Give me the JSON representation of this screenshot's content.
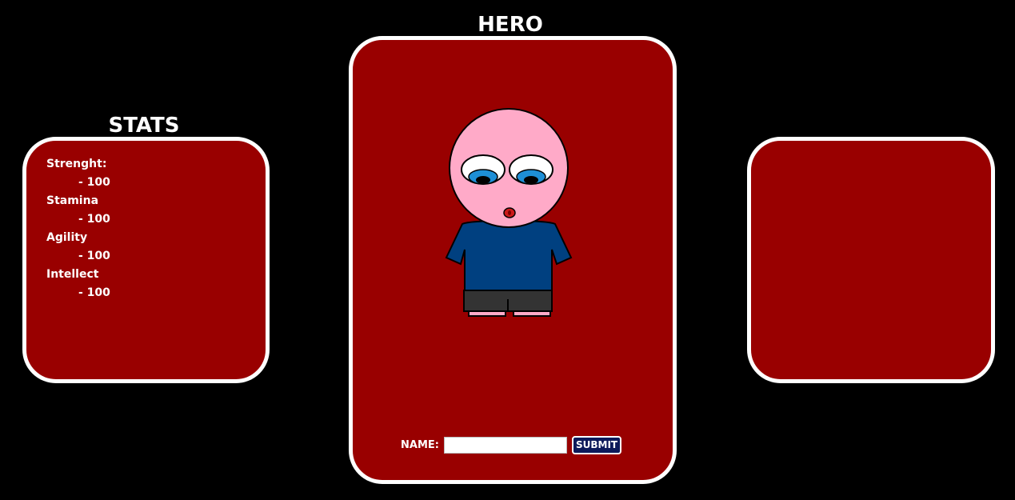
{
  "stats": {
    "title": "STATS",
    "items": [
      {
        "label": "Strenght:",
        "value": "- 100"
      },
      {
        "label": "Stamina",
        "value": "- 100"
      },
      {
        "label": "Agility",
        "value": "- 100"
      },
      {
        "label": "Intellect",
        "value": "- 100"
      }
    ]
  },
  "hero": {
    "title": "HERO",
    "name_label": "NAME:",
    "name_value": "",
    "submit_label": "SUBMIT"
  },
  "colors": {
    "background": "#000000",
    "panel": "#990000",
    "panel_border": "#ffffff",
    "skin": "#ffaac8",
    "shirt": "#004080",
    "shorts": "#333333",
    "iris": "#1e8fd6",
    "button": "#0d1a5a"
  }
}
